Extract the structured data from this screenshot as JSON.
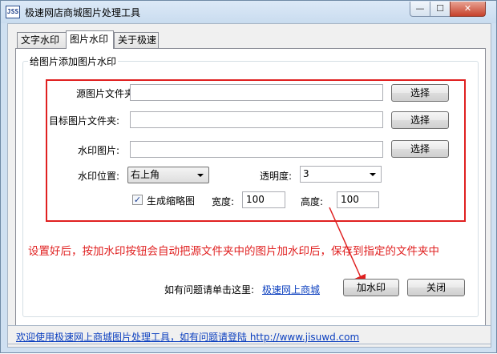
{
  "window": {
    "app_icon_text": "JSS",
    "title": "极速网店商城图片处理工具",
    "min_glyph": "—",
    "max_glyph": "☐",
    "close_glyph": "✕"
  },
  "tabs": [
    {
      "label": "文字水印"
    },
    {
      "label": "图片水印"
    },
    {
      "label": "关于极速"
    }
  ],
  "group": {
    "title": "给图片添加图片水印"
  },
  "form": {
    "source_folder_label": "源图片文件夹:",
    "source_folder_value": "",
    "target_folder_label": "目标图片文件夹:",
    "target_folder_value": "",
    "watermark_image_label": "水印图片:",
    "watermark_image_value": "",
    "select_label": "选择",
    "position_label": "水印位置:",
    "position_value": "右上角",
    "opacity_label": "透明度:",
    "opacity_value": "3",
    "thumbnail_label": "生成缩略图",
    "thumbnail_checked": true,
    "width_label": "宽度:",
    "width_value": "100",
    "height_label": "高度:",
    "height_value": "100"
  },
  "hint": "设置好后，按加水印按钮会自动把源文件夹中的图片加水印后，保存到指定的文件夹中",
  "help": {
    "text": "如有问题请单击这里:",
    "link": "极速网上商城"
  },
  "actions": {
    "add_watermark": "加水印",
    "close": "关闭"
  },
  "status": {
    "text": "欢迎使用极速网上商城图片处理工具，如有问题请登陆 http://www.jisuwd.com"
  },
  "colors": {
    "accent_red": "#e02020",
    "link_blue": "#0b3fbf",
    "window_frame": "#cfe0f1"
  }
}
